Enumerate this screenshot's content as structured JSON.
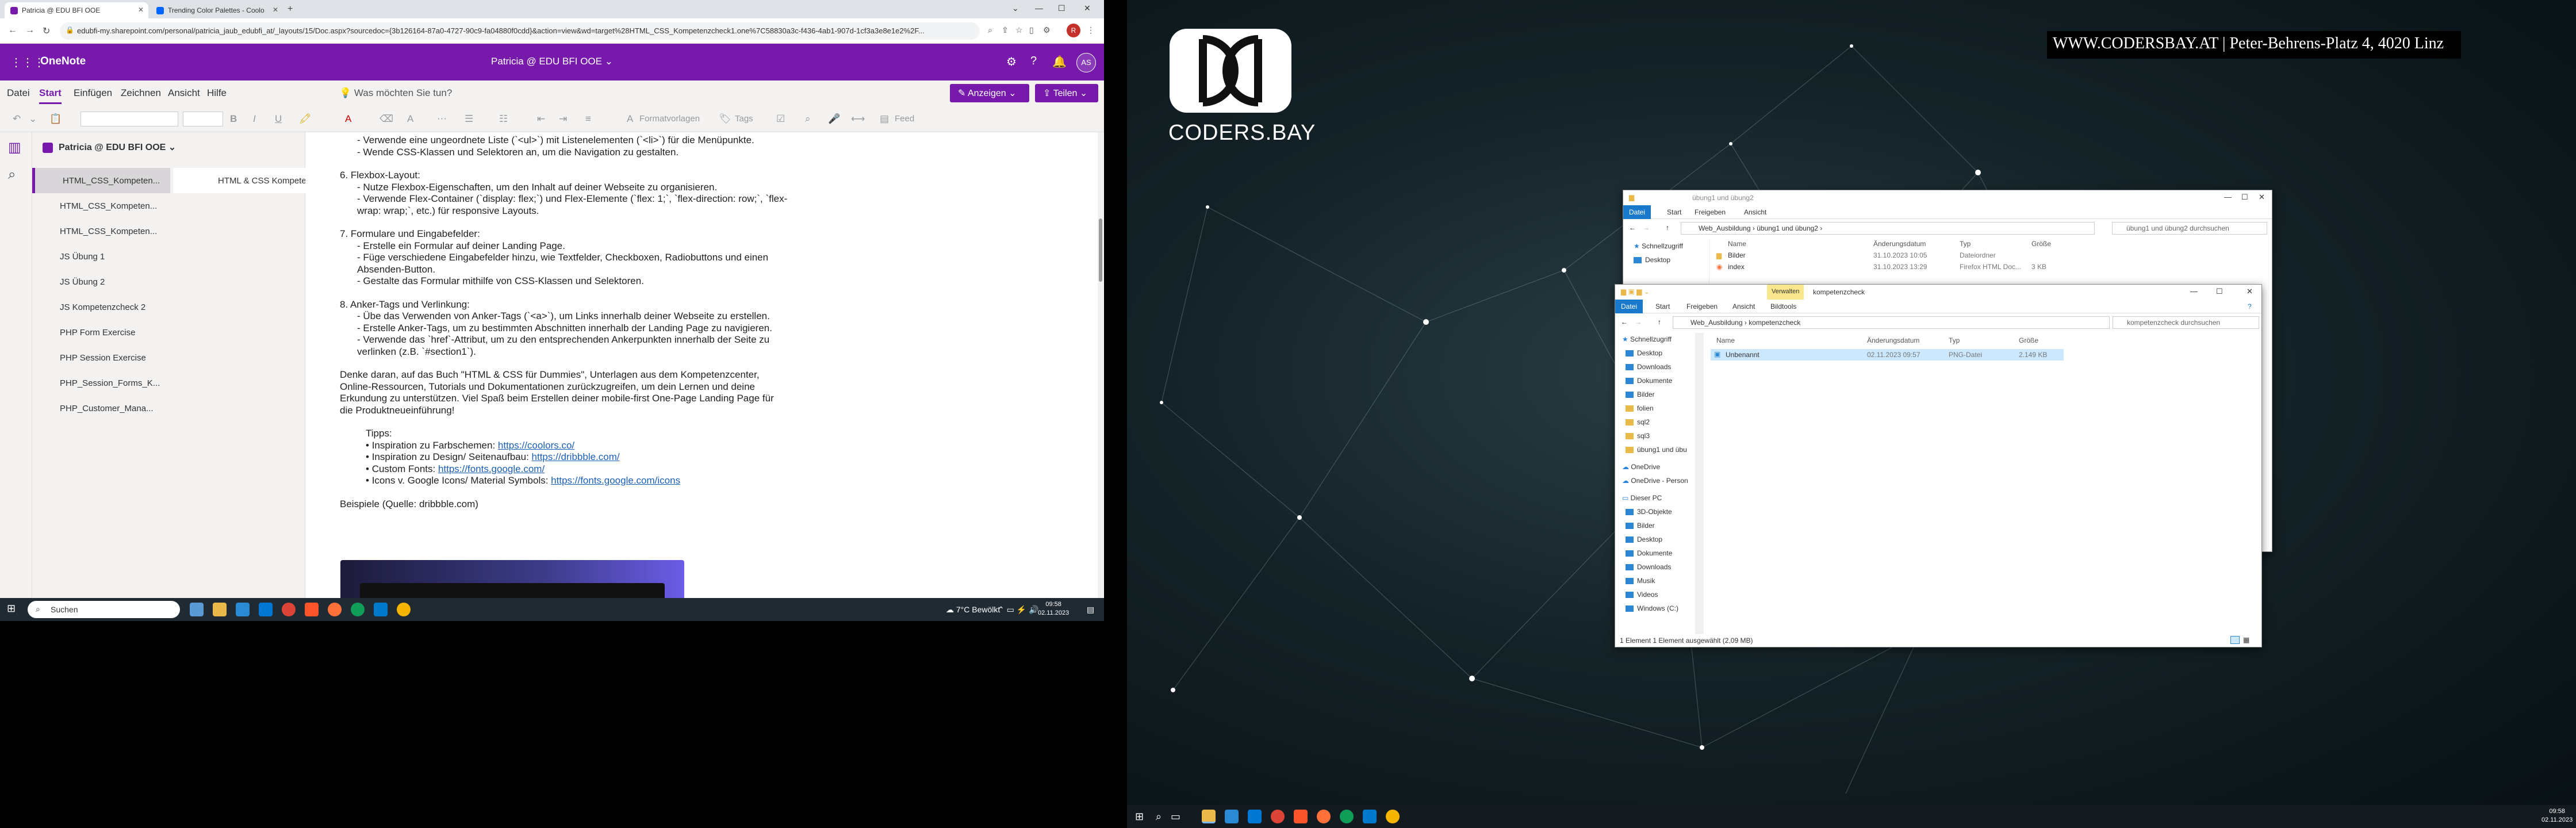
{
  "browser": {
    "tabs": [
      {
        "title": "Patricia @ EDU BFI OOE",
        "color": "#7719aa"
      },
      {
        "title": "Trending Color Palettes - Coolo",
        "color": "#0066ff"
      }
    ],
    "url": "edubfi-my.sharepoint.com/personal/patricia_jaub_edubfi_at/_layouts/15/Doc.aspx?sourcedoc={3b126164-87a0-4727-90c9-fa04880f0cdd}&action=view&wd=target%28HTML_CSS_Kompetenzcheck1.one%7C58830a3c-f436-4ab1-907d-1cf3a3e8e1e2%2F..."
  },
  "onenote": {
    "app_name": "OneNote",
    "doc_title": "Patricia @ EDU BFI OOE ⌄",
    "user_initials": "AS",
    "menu": [
      "Datei",
      "Start",
      "Einfügen",
      "Zeichnen",
      "Ansicht",
      "Hilfe"
    ],
    "active_menu": "Start",
    "tell_me": "Was möchten Sie tun?",
    "show_btn": "Anzeigen",
    "share_btn": "Teilen",
    "toolbar": {
      "styles": "Formatvorlagen",
      "tags": "Tags",
      "feed": "Feed"
    },
    "notebook": "Patricia @ EDU BFI OOE",
    "sections": [
      "HTML_CSS_Kompeten...",
      "HTML_CSS_Kompeten...",
      "HTML_CSS_Kompeten...",
      "JS Übung 1",
      "JS Übung 2",
      "JS Kompetenzcheck 2",
      "PHP Form Exercise",
      "PHP Session Exercise",
      "PHP_Session_Forms_K...",
      "PHP_Customer_Mana..."
    ],
    "page": "HTML & CSS Kompetenz...",
    "content": [
      {
        "t": "- Verwende eine ungeordnete Liste (`<ul>`) mit Listenelementen (`<li>`) für die Menüpunkte."
      },
      {
        "t": "- Wende CSS-Klassen und Selektoren an, um die Navigation zu gestalten."
      },
      {
        "t": ""
      },
      {
        "t": "6. Flexbox-Layout:"
      },
      {
        "t": "- Nutze Flexbox-Eigenschaften, um den Inhalt auf deiner Webseite zu organisieren."
      },
      {
        "t": "- Verwende Flex-Container (`display: flex;`) und Flex-Elemente (`flex: 1;`, `flex-direction: row;`, `flex-wrap: wrap;`, etc.) für responsive Layouts."
      },
      {
        "t": ""
      },
      {
        "t": "7. Formulare und Eingabefelder:"
      },
      {
        "t": "- Erstelle ein Formular auf deiner Landing Page."
      },
      {
        "t": "- Füge verschiedene Eingabefelder hinzu, wie Textfelder, Checkboxen, Radiobuttons und einen Absenden-Button."
      },
      {
        "t": "- Gestalte das Formular mithilfe von CSS-Klassen und Selektoren."
      },
      {
        "t": ""
      },
      {
        "t": "8. Anker-Tags und Verlinkung:"
      },
      {
        "t": "- Übe das Verwenden von Anker-Tags (`<a>`), um Links innerhalb deiner Webseite zu erstellen."
      },
      {
        "t": "- Erstelle Anker-Tags, um zu bestimmten Abschnitten innerhalb der Landing Page zu navigieren."
      },
      {
        "t": "- Verwende das `href`-Attribut, um zu den entsprechenden Ankerpunkten innerhalb der Seite zu verlinken (z.B. `#section1`)."
      },
      {
        "t": ""
      },
      {
        "t": "Denke daran, auf das Buch \"HTML & CSS für Dummies\", Unterlagen aus dem Kompetenzcenter, Online-Ressourcen, Tutorials und Dokumentationen zurückzugreifen, um dein Lernen und deine Erkundung zu unterstützen. Viel Spaß beim Erstellen deiner mobile-first One-Page Landing Page für die Produktneueinführung!"
      },
      {
        "t": ""
      }
    ],
    "tips_title": "Tipps:",
    "tips": [
      {
        "label": "Inspiration zu Farbschemen: ",
        "link": "https://coolors.co/"
      },
      {
        "label": "Inspiration zu Design/ Seitenaufbau: ",
        "link": "https://dribbble.com/"
      },
      {
        "label": "Custom Fonts: ",
        "link": "https://fonts.google.com/"
      },
      {
        "label": "Icons v. Google Icons/ Material Symbols: ",
        "link": "https://fonts.google.com/icons"
      }
    ],
    "examples": "Beispiele (Quelle: dribbble.com)"
  },
  "taskbar1": {
    "search": "Suchen",
    "weather": "7°C  Bewölkt",
    "time": "09:58",
    "date": "02.11.2023"
  },
  "desktop2": {
    "logo_text": "CODERS.BAY",
    "banner": "WWW.CODERSBAY.AT | Peter-Behrens-Platz 4, 4020 Linz",
    "time": "09:58",
    "date": "02.11.2023"
  },
  "explorer_back": {
    "title": "übung1 und übung2",
    "ribbon": [
      "Datei",
      "Start",
      "Freigeben",
      "Ansicht"
    ],
    "path": [
      "Web_Ausbildung",
      "übung1 und übung2"
    ],
    "search": "übung1 und übung2 durchsuchen",
    "quick": "Schnellzugriff",
    "desktop": "Desktop",
    "columns": [
      "Name",
      "Änderungsdatum",
      "Typ",
      "Größe"
    ],
    "rows": [
      {
        "name": "Bilder",
        "date": "31.10.2023 10:05",
        "type": "Dateiordner",
        "size": ""
      },
      {
        "name": "index",
        "date": "31.10.2023 13:29",
        "type": "Firefox HTML Doc...",
        "size": "3 KB"
      }
    ]
  },
  "explorer_front": {
    "title": "kompetenzcheck",
    "context_tab": "Verwalten",
    "ribbon": [
      "Datei",
      "Start",
      "Freigeben",
      "Ansicht",
      "Bildtools"
    ],
    "path": [
      "Web_Ausbildung",
      "kompetenzcheck"
    ],
    "search": "kompetenzcheck durchsuchen",
    "sidebar": [
      "Schnellzugriff",
      "Desktop",
      "Downloads",
      "Dokumente",
      "Bilder",
      "folien",
      "sql2",
      "sql3",
      "übung1 und übu",
      "OneDrive",
      "OneDrive - Person",
      "Dieser PC",
      "3D-Objekte",
      "Bilder",
      "Desktop",
      "Dokumente",
      "Downloads",
      "Musik",
      "Videos",
      "Windows (C:)"
    ],
    "columns": [
      "Name",
      "Änderungsdatum",
      "Typ",
      "Größe"
    ],
    "rows": [
      {
        "name": "Unbenannt",
        "date": "02.11.2023 09:57",
        "type": "PNG-Datei",
        "size": "2.149 KB"
      }
    ],
    "status": "1 Element    1 Element ausgewählt (2,09 MB)"
  }
}
